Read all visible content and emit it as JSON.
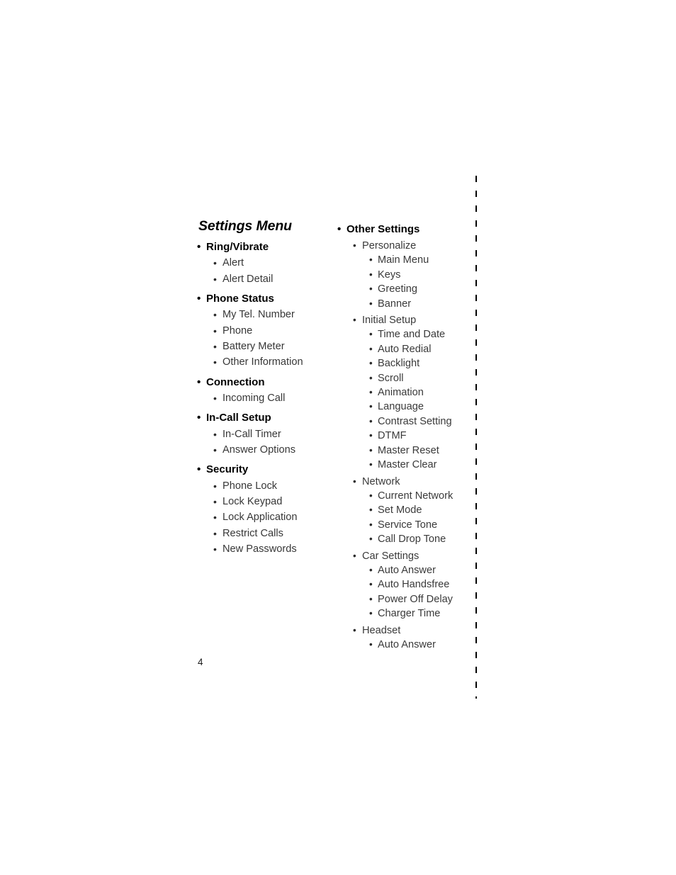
{
  "document": {
    "title": "Settings Menu",
    "page_number": "4",
    "bullet_glyph": "•"
  },
  "left_column": {
    "groups": [
      {
        "label": "Ring/Vibrate",
        "items": [
          "Alert",
          "Alert Detail"
        ]
      },
      {
        "label": "Phone Status",
        "items": [
          "My Tel. Number",
          "Phone",
          "Battery Meter",
          "Other Information"
        ]
      },
      {
        "label": "Connection",
        "items": [
          "Incoming Call"
        ]
      },
      {
        "label": "In-Call Setup",
        "items": [
          "In-Call Timer",
          "Answer Options"
        ]
      },
      {
        "label": "Security",
        "items": [
          "Phone Lock",
          "Lock Keypad",
          "Lock Application",
          "Restrict Calls",
          "New Passwords"
        ]
      }
    ]
  },
  "right_column": {
    "heading": "Other Settings",
    "groups": [
      {
        "label": "Personalize",
        "items": [
          "Main Menu",
          "Keys",
          "Greeting",
          "Banner"
        ]
      },
      {
        "label": "Initial Setup",
        "items": [
          "Time and Date",
          "Auto Redial",
          "Backlight",
          "Scroll",
          "Animation",
          "Language",
          "Contrast Setting",
          "DTMF",
          "Master Reset",
          "Master Clear"
        ]
      },
      {
        "label": "Network",
        "items": [
          "Current Network",
          "Set Mode",
          "Service Tone",
          "Call Drop Tone"
        ]
      },
      {
        "label": "Car Settings",
        "items": [
          "Auto Answer",
          "Auto Handsfree",
          "Power Off Delay",
          "Charger Time"
        ]
      },
      {
        "label": "Headset",
        "items": [
          "Auto Answer"
        ]
      }
    ]
  },
  "colors": {
    "background": "#ffffff",
    "heading_text": "#000000",
    "body_text": "#3a3a3a",
    "rule": "#000000"
  }
}
